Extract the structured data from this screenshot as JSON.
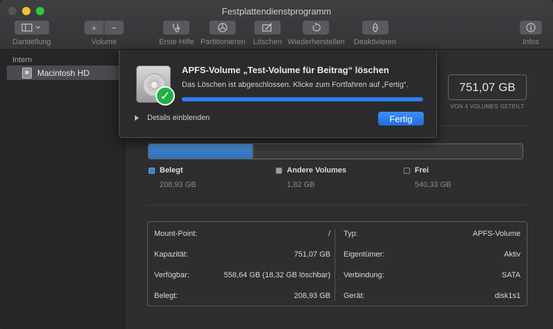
{
  "window": {
    "title": "Festplattendienstprogramm"
  },
  "toolbar": {
    "view_label": "Darstellung",
    "volume_label": "Volume",
    "volume_add_glyph": "+",
    "volume_remove_glyph": "−",
    "first_aid_label": "Erste Hilfe",
    "partition_label": "Partitionieren",
    "erase_label": "Löschen",
    "restore_label": "Wiederherstellen",
    "unmount_label": "Deaktivieren",
    "info_label": "Infos"
  },
  "sidebar": {
    "section_header": "Intern",
    "items": [
      {
        "label": "Macintosh HD"
      }
    ]
  },
  "capacity": {
    "value": "751,07 GB",
    "caption": "VON 4 VOLUMES GETEILT"
  },
  "usage": {
    "used_fraction": 0.278,
    "other_fraction": 0.0024,
    "used_color": "#3b7fd0",
    "legend": [
      {
        "name": "Belegt",
        "value": "208,93 GB",
        "color": "#3b7fd0"
      },
      {
        "name": "Andere Volumes",
        "value": "1,82 GB",
        "color": "#9a9a9c"
      },
      {
        "name": "Frei",
        "value": "540,33 GB",
        "color": "#2e2e30"
      }
    ]
  },
  "info": {
    "left": [
      {
        "key": "Mount-Point:",
        "value": "/"
      },
      {
        "key": "Kapazität:",
        "value": "751,07 GB"
      },
      {
        "key": "Verfügbar:",
        "value": "558,64 GB (18,32 GB löschbar)"
      },
      {
        "key": "Belegt:",
        "value": "208,93 GB"
      }
    ],
    "right": [
      {
        "key": "Typ:",
        "value": "APFS-Volume"
      },
      {
        "key": "Eigentümer:",
        "value": "Aktiv"
      },
      {
        "key": "Verbindung:",
        "value": "SATA"
      },
      {
        "key": "Gerät:",
        "value": "disk1s1"
      }
    ]
  },
  "dialog": {
    "title": "APFS-Volume „Test-Volume für Beitrag“ löschen",
    "message": "Das Löschen ist abgeschlossen. Klicke zum Fortfahren auf „Fertig“.",
    "progress": 1.0,
    "details_label": "Details einblenden",
    "done_label": "Fertig",
    "check_glyph": "✓"
  }
}
